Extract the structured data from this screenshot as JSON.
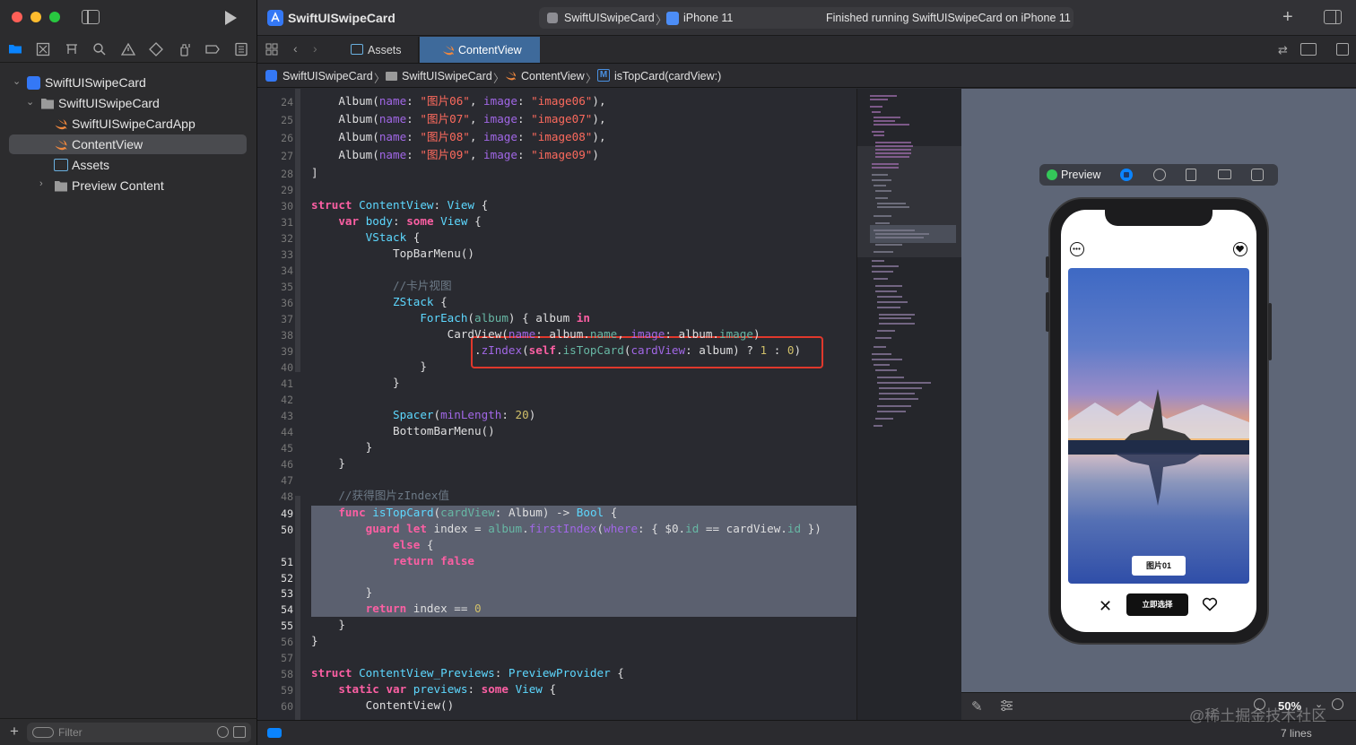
{
  "window": {
    "title": "SwiftUISwipeCard",
    "scheme": "SwiftUISwipeCard",
    "device": "iPhone 11",
    "status": "Finished running SwiftUISwipeCard on iPhone 11"
  },
  "tabs": [
    {
      "label": "Assets",
      "active": false
    },
    {
      "label": "ContentView",
      "active": true
    }
  ],
  "jumpbar": [
    "SwiftUISwipeCard",
    "SwiftUISwipeCard",
    "ContentView",
    "isTopCard(cardView:)"
  ],
  "jump_m_badge": "M",
  "navigator": {
    "items": [
      {
        "label": "SwiftUISwipeCard",
        "icon": "project-icon",
        "level": 0,
        "chevron": "down"
      },
      {
        "label": "SwiftUISwipeCard",
        "icon": "folder-icon",
        "level": 1,
        "chevron": "down"
      },
      {
        "label": "SwiftUISwipeCardApp",
        "icon": "swift-file-icon",
        "level": 2
      },
      {
        "label": "ContentView",
        "icon": "swift-file-icon",
        "level": 2,
        "selected": true
      },
      {
        "label": "Assets",
        "icon": "asset-catalog-icon",
        "level": 2
      },
      {
        "label": "Preview Content",
        "icon": "folder-icon",
        "level": 2,
        "chevron": "right"
      }
    ],
    "filter_placeholder": "Filter"
  },
  "code": {
    "line_numbers": [
      "24",
      "25",
      "26",
      "27",
      "28",
      "29",
      "30",
      "31",
      "32",
      "33",
      "34",
      "35",
      "36",
      "37",
      "38",
      "39",
      "40",
      "41",
      "42",
      "43",
      "44",
      "45",
      "46",
      "47",
      "48",
      "49",
      "50",
      "",
      "51",
      "52",
      "53",
      "54",
      "55",
      "56",
      "57",
      "58",
      "59",
      "60"
    ],
    "current_lines": [
      "49",
      "50",
      "51",
      "52",
      "53",
      "54",
      "55"
    ]
  },
  "preview": {
    "label": "Preview",
    "card_caption": "图片01",
    "select_button": "立即选择",
    "zoom": "50%",
    "status_line_count": "7 lines"
  },
  "watermark": "@稀土掘金技术社区",
  "colors": {
    "accent": "#0a84ff",
    "highlight_box": "#e0382c",
    "selection": "#5b606f"
  }
}
